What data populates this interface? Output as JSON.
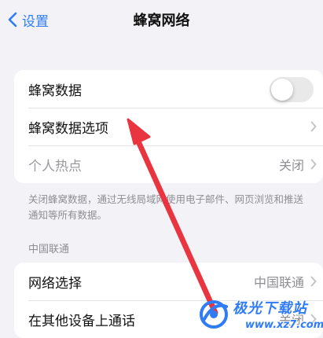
{
  "nav": {
    "back_label": "设置",
    "title": "蜂窝网络"
  },
  "group1": {
    "rows": [
      {
        "label": "蜂窝数据",
        "control": "toggle",
        "toggle_on": false
      },
      {
        "label": "蜂窝数据选项",
        "control": "chevron"
      },
      {
        "label": "个人热点",
        "value": "关闭",
        "control": "chevron",
        "dimmed": true
      }
    ]
  },
  "footnote": "关闭蜂窝数据，通过无线局域网使用电子邮件、网页浏览和推送通知等所有数据。",
  "carrier_section": {
    "header": "中国联通",
    "rows": [
      {
        "label": "网络选择",
        "value": "中国联通",
        "control": "chevron"
      },
      {
        "label": "在其他设备上通话",
        "value": "关闭",
        "control": "chevron"
      }
    ]
  },
  "watermark": {
    "brand": "极光下载站",
    "url": "www.xz7.com"
  },
  "colors": {
    "accent": "#2f7cf6",
    "annotation_arrow": "#e8353f",
    "background": "#f2f2f7"
  }
}
